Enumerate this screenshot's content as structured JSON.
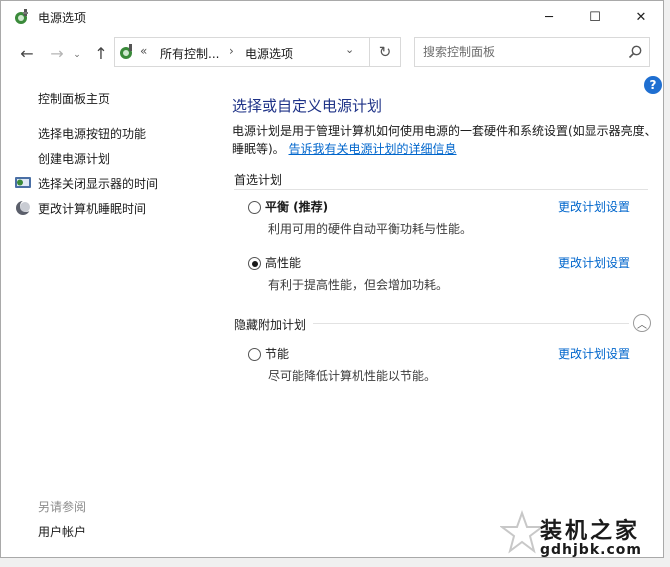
{
  "window": {
    "title": "电源选项",
    "controls": {
      "minimize": "─",
      "maximize": "☐",
      "close": "✕"
    }
  },
  "address": {
    "separator": "«",
    "crumb_separator": "›",
    "crumbs": [
      "所有控制...",
      "电源选项"
    ],
    "dropdown": "⌄",
    "refresh": "↻"
  },
  "nav": {
    "back": "←",
    "forward": "→",
    "history": "⌄",
    "up": "↑"
  },
  "search": {
    "placeholder": "搜索控制面板"
  },
  "help": {
    "label": "?"
  },
  "sidebar": {
    "home": "控制面板主页",
    "items": [
      {
        "label": "选择电源按钮的功能",
        "icon": ""
      },
      {
        "label": "创建电源计划",
        "icon": ""
      },
      {
        "label": "选择关闭显示器的时间",
        "icon": "monitor-schedule-icon"
      },
      {
        "label": "更改计算机睡眠时间",
        "icon": "sleep-moon-icon"
      }
    ],
    "see_also": "另请参阅",
    "user_accounts": "用户帐户"
  },
  "main": {
    "title": "选择或自定义电源计划",
    "description": "电源计划是用于管理计算机如何使用电源的一套硬件和系统设置(如显示器亮度、睡眠等)。",
    "description_link": "告诉我有关电源计划的详细信息",
    "preferred_header": "首选计划",
    "hidden_header": "隐藏附加计划",
    "plans": [
      {
        "name": "平衡 (推荐)",
        "desc": "利用可用的硬件自动平衡功耗与性能。",
        "link": "更改计划设置",
        "selected": false
      },
      {
        "name": "高性能",
        "desc": "有利于提高性能，但会增加功耗。",
        "link": "更改计划设置",
        "selected": true
      },
      {
        "name": "节能",
        "desc": "尽可能降低计算机性能以节能。",
        "link": "更改计划设置",
        "selected": false
      }
    ]
  },
  "watermark": {
    "name": "装机之家",
    "domain": "gdhjbk.com"
  }
}
